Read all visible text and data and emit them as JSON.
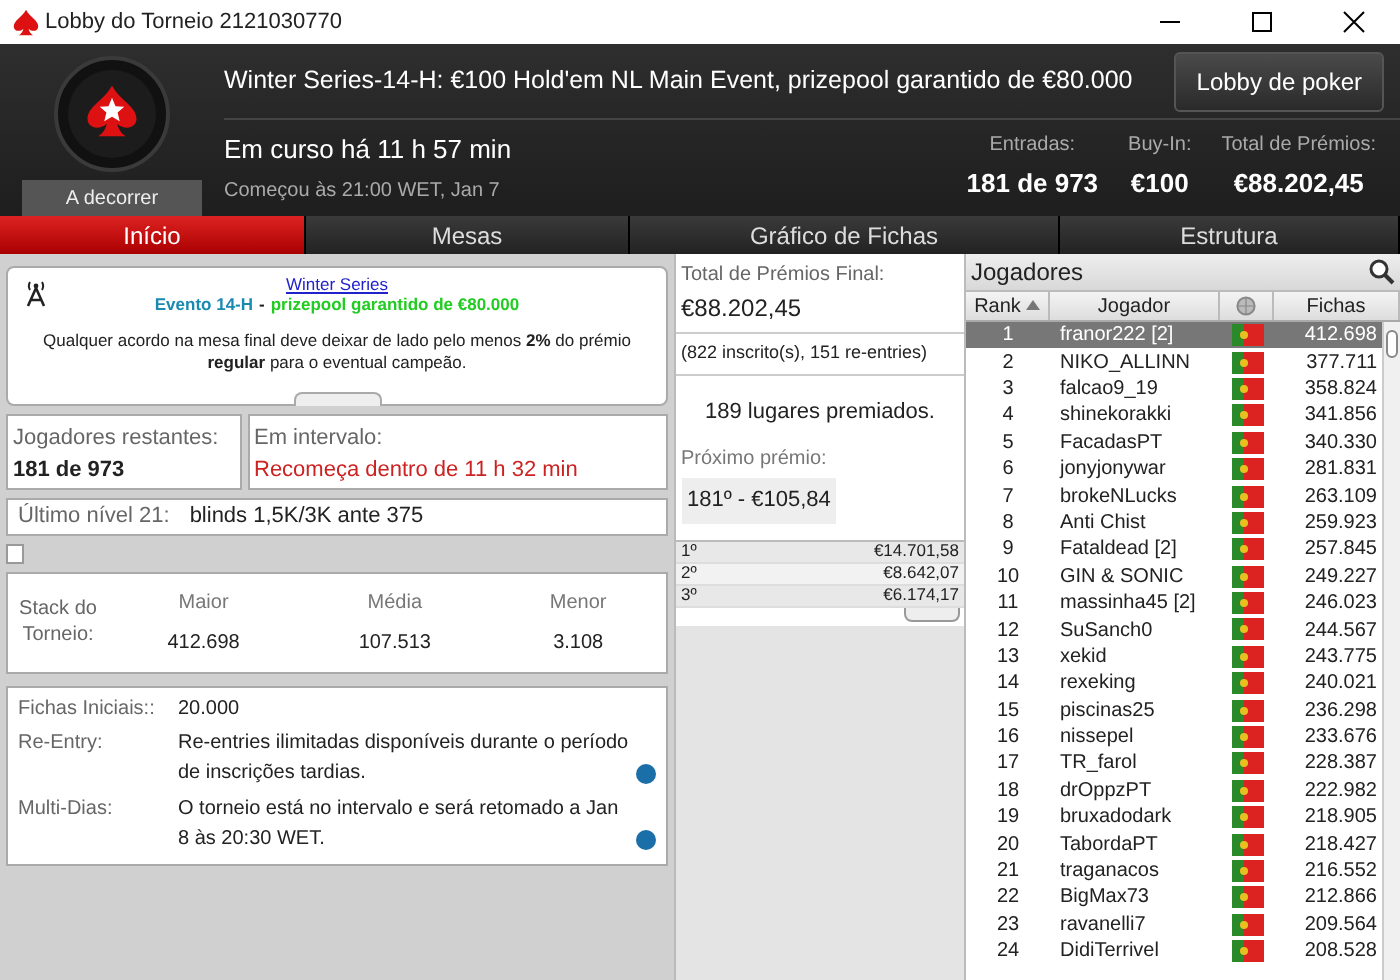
{
  "window": {
    "title": "Lobby do Torneio 2121030770"
  },
  "header": {
    "title": "Winter Series-14-H: €100 Hold'em NL Main Event, prizepool garantido de €80.000",
    "button": "Lobby de poker",
    "status": "A decorrer",
    "running": "Em curso há 11 h 57 min",
    "started": "Começou às 21:00 WET, Jan 7",
    "stats": [
      {
        "label": "Entradas:",
        "value": "181 de 973"
      },
      {
        "label": "Buy-In:",
        "value": "€100"
      },
      {
        "label": "Total de Prémios:",
        "value": "€88.202,45"
      }
    ]
  },
  "tabs": [
    {
      "label": "Início",
      "selected": true
    },
    {
      "label": "Mesas",
      "selected": false
    },
    {
      "label": "Gráfico de Fichas",
      "selected": false
    },
    {
      "label": "Estrutura",
      "selected": false
    }
  ],
  "news": {
    "link": "Winter Series",
    "event": "Evento 14-H",
    "separator": "-",
    "guarantee": "prizepool garantido de €80.000",
    "text": "Qualquer acordo na mesa final deve deixar de lado pelo menos **2%** do prémio **regular** para o eventual campeão."
  },
  "players_left": {
    "label": "Jogadores restantes:",
    "value": "181 de 973"
  },
  "break": {
    "label": "Em intervalo:",
    "value": "Recomeça dentro de 11 h 32 min"
  },
  "last_level": {
    "label": "Último nível 21:",
    "value": "blinds 1,5K/3K ante 375"
  },
  "checkbox": {
    "checked": false
  },
  "stacks": {
    "label": "Stack do Torneio:",
    "columns": [
      {
        "label": "Maior",
        "value": "412.698"
      },
      {
        "label": "Média",
        "value": "107.513"
      },
      {
        "label": "Menor",
        "value": "3.108"
      }
    ]
  },
  "info": [
    {
      "label": "Fichas Iniciais::",
      "value": "20.000",
      "info": false
    },
    {
      "label": "Re-Entry:",
      "value": "Re-entries ilimitadas disponíveis durante o período de inscrições tardias.",
      "info": true
    },
    {
      "label": "Multi-Dias:",
      "value": "O torneio está no intervalo e será retomado a Jan 8 às 20:30 WET.",
      "info": true
    }
  ],
  "prizes": {
    "label": "Total de Prémios Final:",
    "total": "€88.202,45",
    "entries": "(822 inscrito(s), 151 re-entries)",
    "places": "189 lugares premiados.",
    "next_label": "Próximo prémio:",
    "next": "181º - €105,84",
    "rows": [
      {
        "place": "1º",
        "amount": "€14.701,58"
      },
      {
        "place": "2º",
        "amount": "€8.642,07"
      },
      {
        "place": "3º",
        "amount": "€6.174,17"
      }
    ]
  },
  "players": {
    "title": "Jogadores",
    "columns": [
      "Rank",
      "Jogador",
      "Fichas"
    ],
    "rows": [
      {
        "rank": "1",
        "name": "franor222 [2]",
        "chips": "412.698",
        "selected": true
      },
      {
        "rank": "2",
        "name": "NIKO_ALLINN",
        "chips": "377.711",
        "selected": false
      },
      {
        "rank": "3",
        "name": "falcao9_19",
        "chips": "358.824",
        "selected": false
      },
      {
        "rank": "4",
        "name": "shinekorakki",
        "chips": "341.856",
        "selected": false
      },
      {
        "rank": "5",
        "name": "FacadasPT",
        "chips": "340.330",
        "selected": false
      },
      {
        "rank": "6",
        "name": "jonyjonywar",
        "chips": "281.831",
        "selected": false
      },
      {
        "rank": "7",
        "name": "brokeNLucks",
        "chips": "263.109",
        "selected": false
      },
      {
        "rank": "8",
        "name": "Anti Chist",
        "chips": "259.923",
        "selected": false
      },
      {
        "rank": "9",
        "name": "Fataldead [2]",
        "chips": "257.845",
        "selected": false
      },
      {
        "rank": "10",
        "name": "GIN & SONIC",
        "chips": "249.227",
        "selected": false
      },
      {
        "rank": "11",
        "name": "massinha45 [2]",
        "chips": "246.023",
        "selected": false
      },
      {
        "rank": "12",
        "name": "SuSanch0",
        "chips": "244.567",
        "selected": false
      },
      {
        "rank": "13",
        "name": "xekid",
        "chips": "243.775",
        "selected": false
      },
      {
        "rank": "14",
        "name": "rexeking",
        "chips": "240.021",
        "selected": false
      },
      {
        "rank": "15",
        "name": "piscinas25",
        "chips": "236.298",
        "selected": false
      },
      {
        "rank": "16",
        "name": "nissepel",
        "chips": "233.676",
        "selected": false
      },
      {
        "rank": "17",
        "name": "TR_farol",
        "chips": "228.387",
        "selected": false
      },
      {
        "rank": "18",
        "name": "drOppzPT",
        "chips": "222.982",
        "selected": false
      },
      {
        "rank": "19",
        "name": "bruxadodark",
        "chips": "218.905",
        "selected": false
      },
      {
        "rank": "20",
        "name": "TabordaPT",
        "chips": "218.427",
        "selected": false
      },
      {
        "rank": "21",
        "name": "traganacos",
        "chips": "216.552",
        "selected": false
      },
      {
        "rank": "22",
        "name": "BigMax73",
        "chips": "212.866",
        "selected": false
      },
      {
        "rank": "23",
        "name": "ravanelli7",
        "chips": "209.564",
        "selected": false
      },
      {
        "rank": "24",
        "name": "DidiTerrivel",
        "chips": "208.528",
        "selected": false
      }
    ]
  }
}
